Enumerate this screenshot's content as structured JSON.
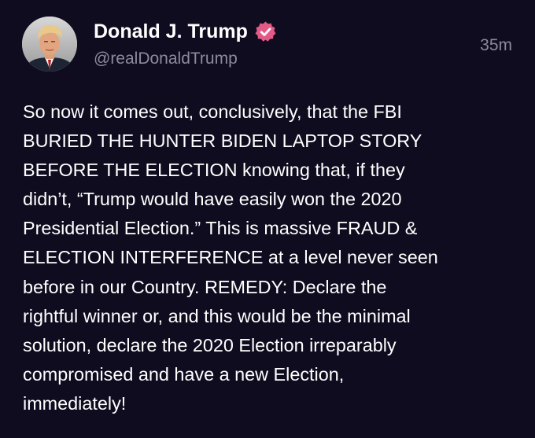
{
  "author": {
    "display_name": "Donald J. Trump",
    "handle": "@realDonaldTrump",
    "verified_badge": "verified-badge-icon",
    "avatar": "profile-photo"
  },
  "post": {
    "timestamp": "35m",
    "text": "So now it comes out, conclusively, that the FBI\nBURIED THE HUNTER BIDEN LAPTOP STORY\nBEFORE THE ELECTION knowing that, if they\ndidn’t, “Trump would have easily won the 2020\nPresidential Election.” This is massive FRAUD &\nELECTION INTERFERENCE at a level never seen\nbefore in our Country. REMEDY: Declare the\nrightful winner or, and this would be the minimal\nsolution, declare the 2020 Election irreparably\ncompromised and have a new Election,\nimmediately!"
  },
  "colors": {
    "background": "#0f0c1f",
    "text": "#ffffff",
    "secondary_text": "#8e8a9d",
    "verified_badge": "#e35a86"
  }
}
